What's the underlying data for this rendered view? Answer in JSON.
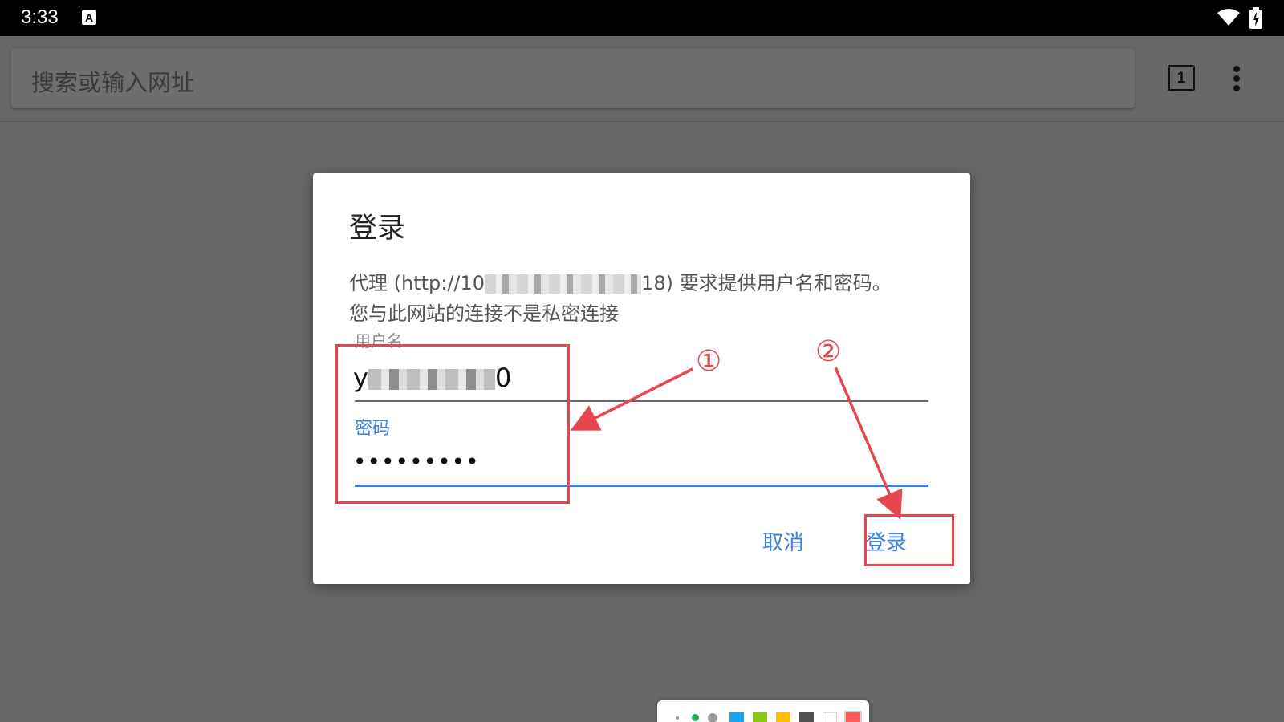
{
  "status_bar": {
    "time": "3:33",
    "notification_icon_letter": "A"
  },
  "toolbar": {
    "omnibox_placeholder": "搜索或输入网址",
    "tab_count": "1"
  },
  "dialog": {
    "title": "登录",
    "message_prefix": "代理 (http://10",
    "message_suffix": "18) 要求提供用户名和密码。",
    "message_line2": "您与此网站的连接不是私密连接",
    "username_label": "用户名",
    "username_prefix": "y",
    "username_suffix": "0",
    "password_label": "密码",
    "password_value": "•••••••••",
    "cancel_label": "取消",
    "login_label": "登录"
  },
  "annotations": {
    "step1": "①",
    "step2": "②",
    "color": "#e8464e"
  },
  "colors": {
    "accent": "#3d7fe0",
    "scrim": "#666666"
  },
  "palette": {
    "swatches": [
      "#19a3f0",
      "#8bc816",
      "#ffbf00",
      "#505050",
      "#ffffff",
      "#ff5a5a"
    ]
  }
}
